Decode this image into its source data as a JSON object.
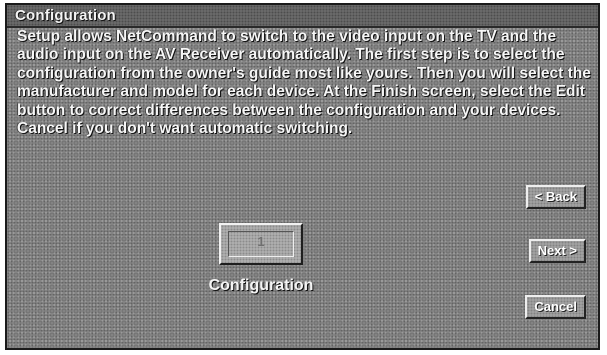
{
  "window": {
    "title": "Configuration"
  },
  "description": "Setup allows NetCommand to switch to the video input on the TV and the audio input on the AV Receiver automatically. The first step is to select the configuration from the owner's guide most like yours. Then you will select the manufacturer and model for each device.  At the Finish screen, select the Edit button to correct differences between the configuration and your devices. Cancel if you don't want automatic switching.",
  "buttons": {
    "back": "< Back",
    "next": "Next >",
    "cancel": "Cancel"
  },
  "config_tile": {
    "number": "1",
    "label": "Configuration"
  }
}
